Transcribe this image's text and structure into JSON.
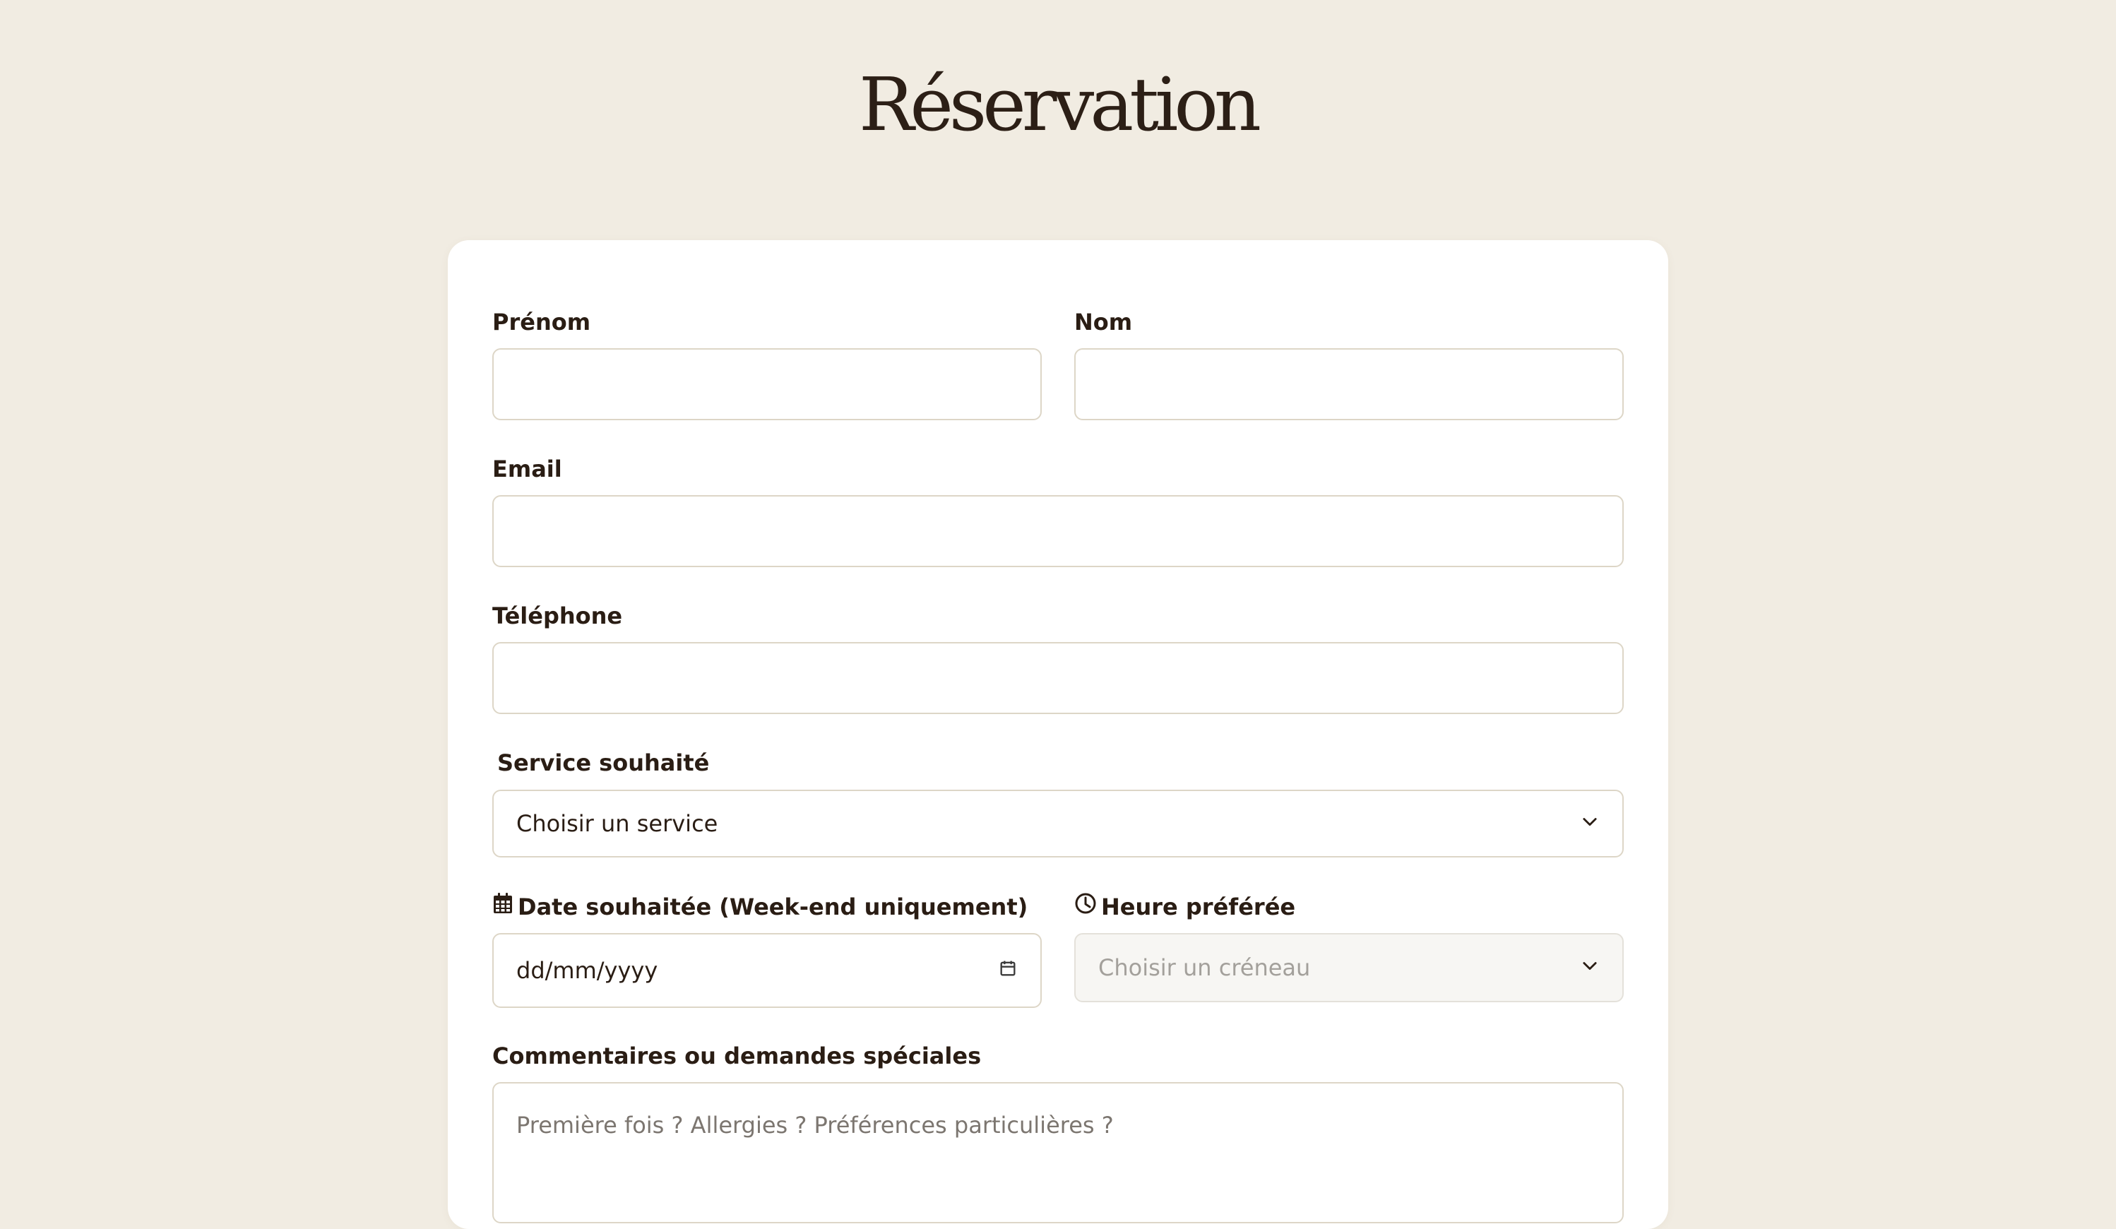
{
  "page": {
    "title": "Réservation"
  },
  "form": {
    "first_name": {
      "label": "Prénom",
      "value": ""
    },
    "last_name": {
      "label": "Nom",
      "value": ""
    },
    "email": {
      "label": "Email",
      "value": ""
    },
    "phone": {
      "label": "Téléphone",
      "value": ""
    },
    "service": {
      "label": "Service souhaité",
      "selected": "Choisir un service",
      "icon": "chevron-down-icon"
    },
    "date": {
      "label": "Date souhaitée (Week-end uniquement)",
      "value": "dd/mm/yyyy",
      "label_icon": "calendar-icon",
      "picker_icon": "calendar-icon"
    },
    "time": {
      "label": "Heure préférée",
      "selected": "Choisir un créneau",
      "label_icon": "clock-icon",
      "disabled": true,
      "icon": "chevron-down-icon"
    },
    "comments": {
      "label": "Commentaires ou demandes spéciales",
      "placeholder": "Première fois ? Allergies ? Préférences particulières ?",
      "value": ""
    }
  },
  "colors": {
    "background": "#f1ece2",
    "card": "#ffffff",
    "text": "#2a1d14",
    "border": "#ddd6c7",
    "disabled_bg": "#f7f6f3",
    "placeholder": "#7c7670"
  }
}
